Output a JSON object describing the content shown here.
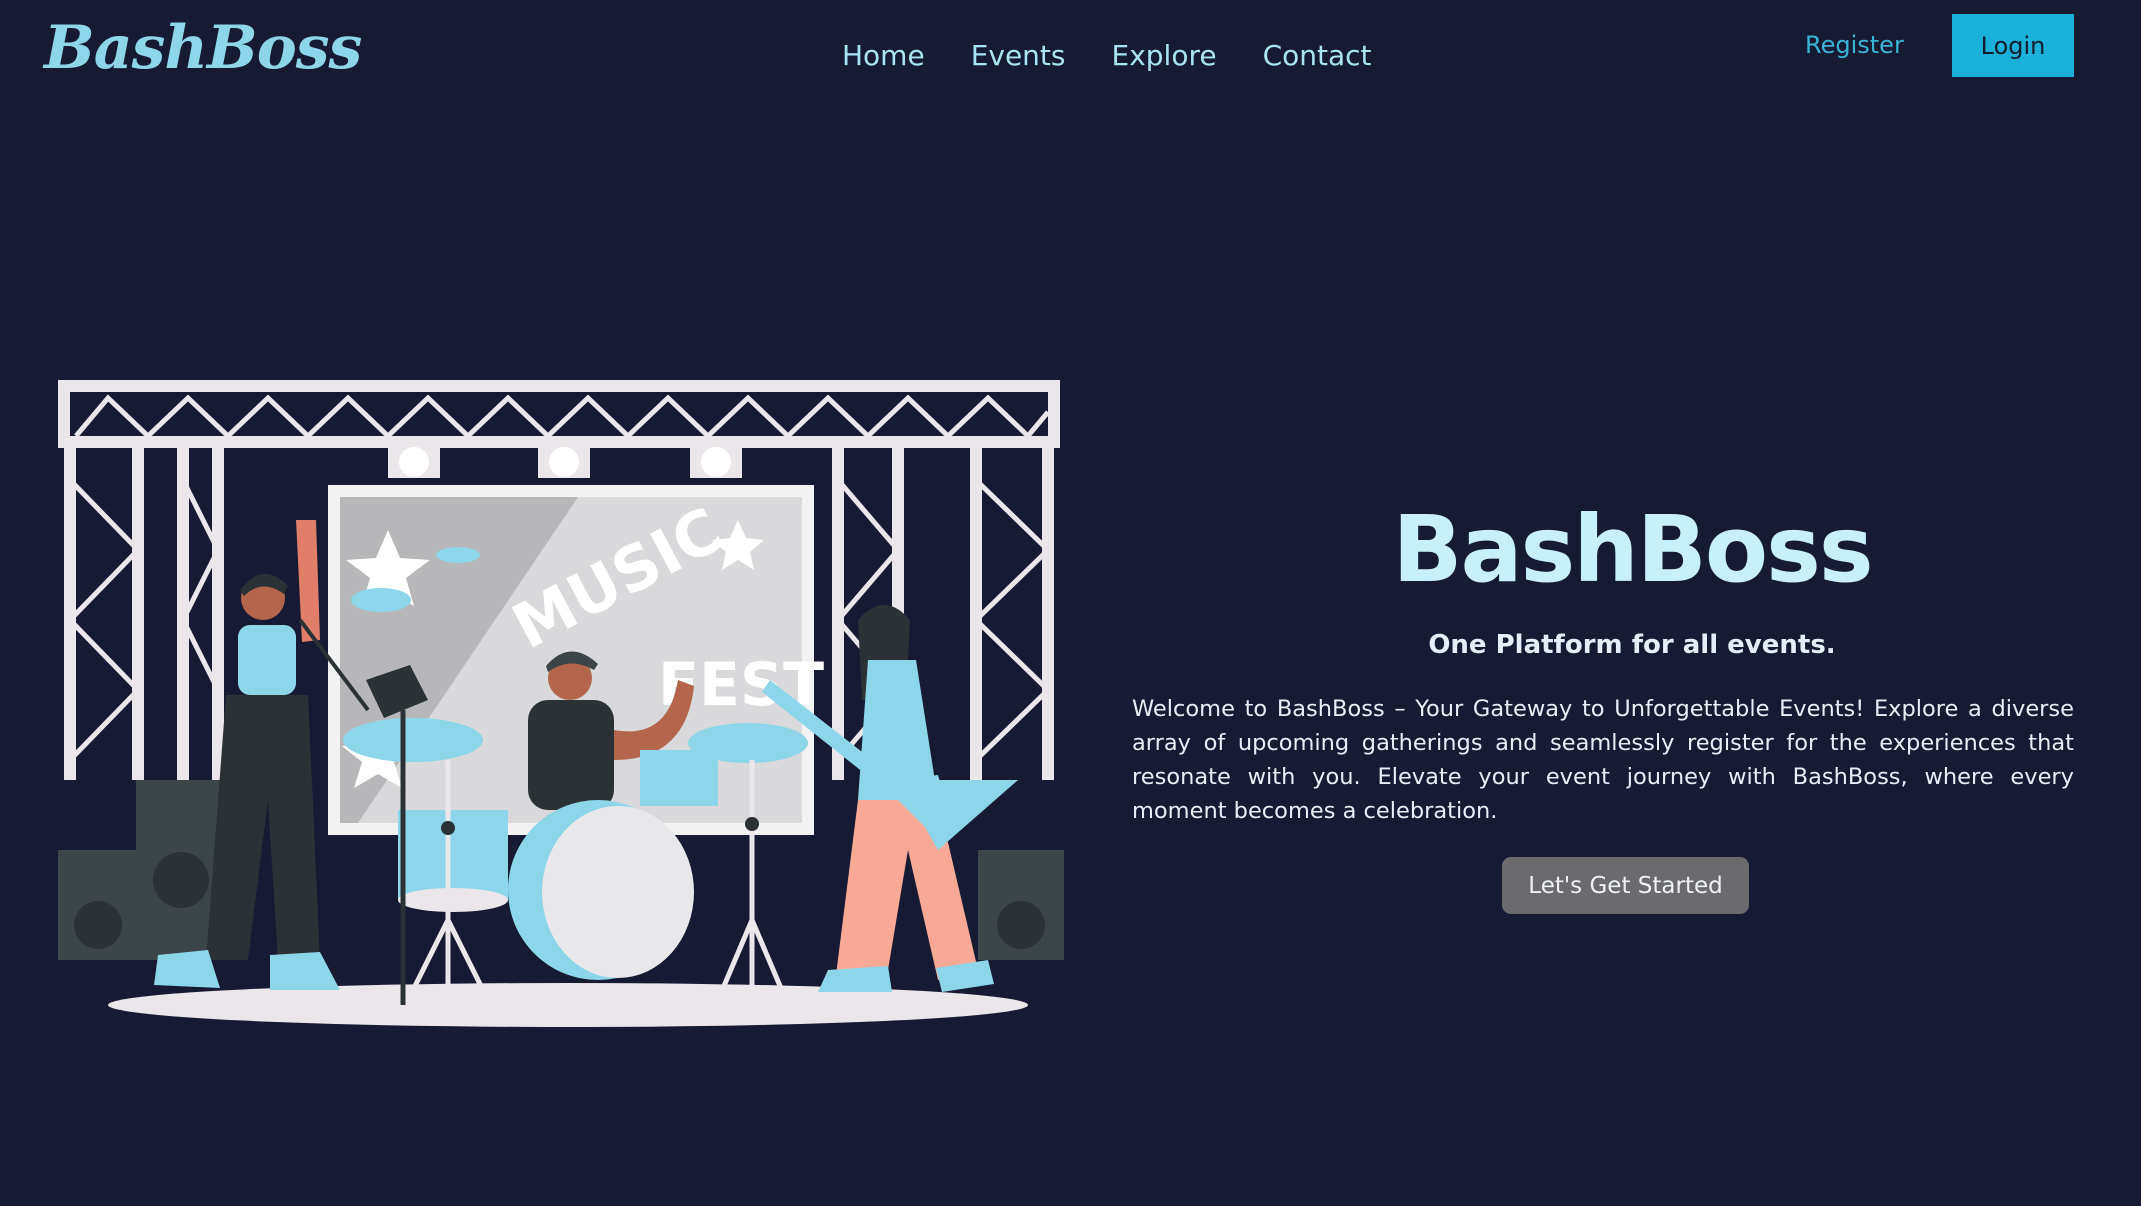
{
  "header": {
    "logo": "BashBoss",
    "nav": [
      "Home",
      "Events",
      "Explore",
      "Contact"
    ],
    "register_label": "Register",
    "login_label": "Login"
  },
  "illustration": {
    "banner_line1": "MUSIC",
    "banner_line2": "FEST"
  },
  "hero": {
    "title": "BashBoss",
    "subtitle": "One Platform for all events.",
    "description": "Welcome to BashBoss – Your Gateway to Unforgettable Events! Explore a diverse array of upcoming gatherings and seamlessly register for the experiences that resonate with you. Elevate your event journey with BashBoss, where every moment becomes a celebration.",
    "cta_label": "Let's Get Started"
  },
  "colors": {
    "background": "#161a33",
    "accent": "#1bb0d8",
    "logo": "#8dd6ea",
    "title": "#c7f0fb",
    "button": "#6b6b6e"
  }
}
